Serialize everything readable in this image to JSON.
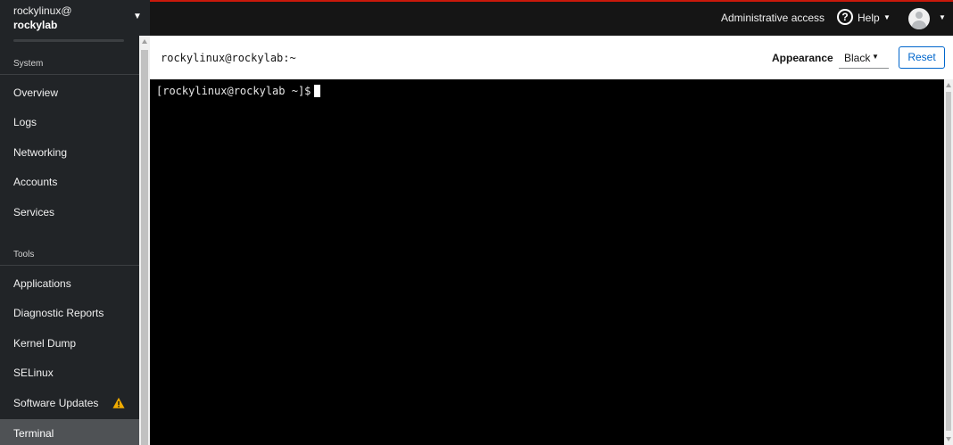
{
  "host": {
    "user": "rockylinux@",
    "name": "rockylab"
  },
  "sidebar": {
    "sections": [
      {
        "label": "System",
        "items": [
          "Overview",
          "Logs",
          "Networking",
          "Accounts",
          "Services"
        ]
      },
      {
        "label": "Tools",
        "items": [
          "Applications",
          "Diagnostic Reports",
          "Kernel Dump",
          "SELinux",
          "Software Updates",
          "Terminal"
        ]
      }
    ],
    "active_item": "Terminal",
    "warning_item": "Software Updates"
  },
  "topbar": {
    "admin_access": "Administrative access",
    "help_label": "Help",
    "help_icon": "question-circle-icon",
    "avatar_icon": "user-avatar-icon"
  },
  "header": {
    "title": "rockylinux@rockylab:~",
    "appearance_label": "Appearance",
    "appearance_value": "Black",
    "reset_label": "Reset"
  },
  "terminal": {
    "prompt": "[rockylinux@rockylab ~]$"
  },
  "colors": {
    "sidebar_bg": "#212427",
    "active_bg": "#4f5255",
    "topbar_bg": "#151515",
    "accent_red": "#c9190b",
    "link_blue": "#0066cc",
    "warning": "#f0ab00",
    "terminal_bg": "#000000"
  }
}
